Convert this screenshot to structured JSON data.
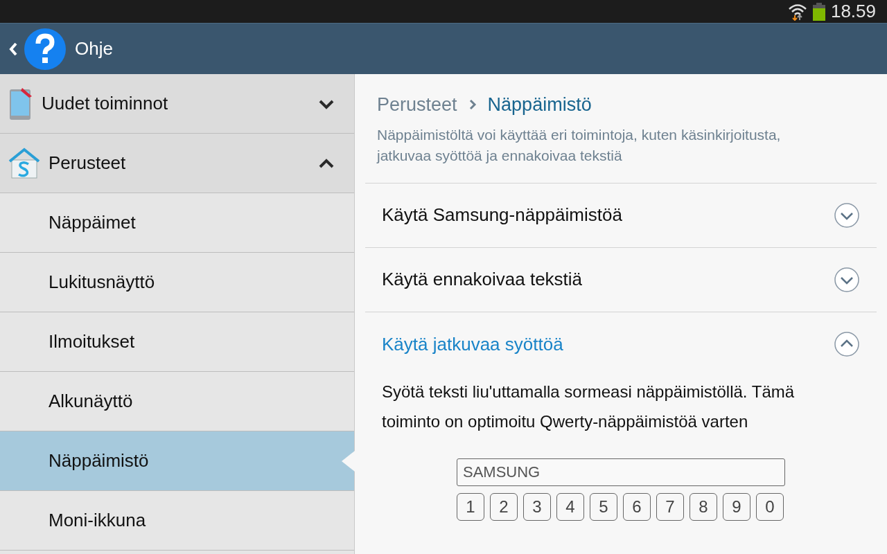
{
  "status_bar": {
    "time": "18.59"
  },
  "action_bar": {
    "title": "Ohje"
  },
  "sidebar": {
    "sections": [
      {
        "label": "Uudet toiminnot",
        "kind": "tablet",
        "expanded": false
      },
      {
        "label": "Perusteet",
        "kind": "house",
        "expanded": true,
        "children": [
          {
            "label": "Näppäimet",
            "selected": false
          },
          {
            "label": "Lukitusnäyttö",
            "selected": false
          },
          {
            "label": "Ilmoitukset",
            "selected": false
          },
          {
            "label": "Alkunäyttö",
            "selected": false
          },
          {
            "label": "Näppäimistö",
            "selected": true
          },
          {
            "label": "Moni-ikkuna",
            "selected": false
          }
        ]
      }
    ]
  },
  "content": {
    "breadcrumb": {
      "parent": "Perusteet",
      "current": "Näppäimistö"
    },
    "description": "Näppäimistöltä voi käyttää eri toimintoja, kuten käsinkirjoitusta, jatkuvaa syöttöä ja ennakoivaa tekstiä",
    "topics": [
      {
        "title": "Käytä Samsung-näppäimistöä",
        "expanded": false
      },
      {
        "title": "Käytä ennakoivaa tekstiä",
        "expanded": false
      },
      {
        "title": "Käytä jatkuvaa syöttöä",
        "expanded": true,
        "body": "Syötä teksti liu'uttamalla sormeasi näppäimistöllä. Tämä toiminto on optimoitu Qwerty-näppäimistöä varten",
        "demo": {
          "field": "SAMSUNG",
          "keys": [
            "1",
            "2",
            "3",
            "4",
            "5",
            "6",
            "7",
            "8",
            "9",
            "0"
          ]
        }
      }
    ]
  }
}
